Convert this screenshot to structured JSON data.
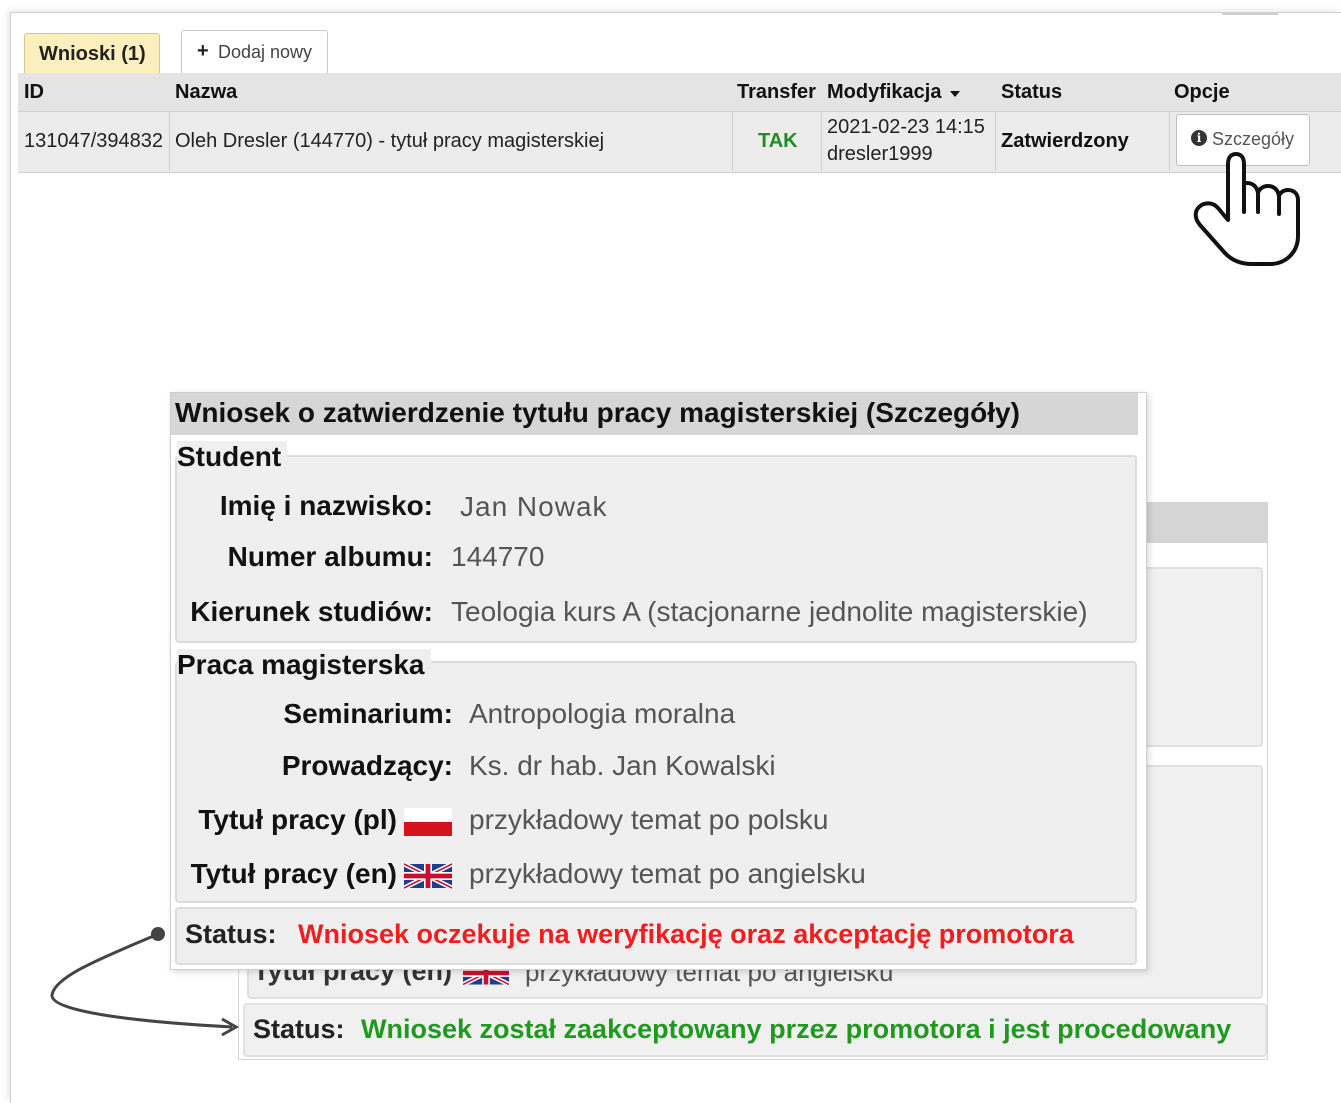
{
  "tabs": {
    "active_label": "Wnioski (1)",
    "add_icon": "+",
    "add_label": "Dodaj nowy"
  },
  "table": {
    "headers": {
      "id": "ID",
      "name": "Nazwa",
      "transfer": "Transfer",
      "modified": "Modyfikacja",
      "status": "Status",
      "options": "Opcje"
    },
    "sort_icon": "caret-down-icon",
    "row": {
      "id": "131047/394832",
      "name": "Oleh Dresler (144770) - tytuł pracy magisterskiej",
      "transfer": "TAK",
      "modified_date": "2021-02-23 14:15",
      "modified_user": "dresler1999",
      "status": "Zatwierdzony",
      "details_label": "Szczegóły"
    }
  },
  "details": {
    "title": "Wniosek o zatwierdzenie tytułu pracy magisterskiej (Szczegóły)",
    "student_legend": "Student",
    "student": {
      "name_label": "Imię i nazwisko:",
      "name_value": "Jan Nowak",
      "album_label": "Numer albumu:",
      "album_value": "144770",
      "field_label": "Kierunek studiów:",
      "field_value": "Teologia kurs A (stacjonarne jednolite magisterskie)"
    },
    "thesis_legend": "Praca magisterska",
    "thesis": {
      "seminar_label": "Seminarium:",
      "seminar_value": "Antropologia moralna",
      "supervisor_label": "Prowadzący:",
      "supervisor_value": "Ks. dr hab. Jan Kowalski",
      "title_pl_label": "Tytuł pracy (pl)",
      "title_pl_value": "przykładowy temat po polsku",
      "title_en_label": "Tytuł pracy (en)",
      "title_en_value": "przykładowy temat po angielsku"
    },
    "status_label": "Status:",
    "status_pending": "Wniosek oczekuje na weryfikację oraz akceptację promotora",
    "status_approved": "Wniosek został zaakceptowany przez promotora i jest procedowany"
  },
  "colors": {
    "active_tab": "#fbefbd",
    "ok_green": "#1f9a1f",
    "pending_red": "#f01e1e"
  }
}
